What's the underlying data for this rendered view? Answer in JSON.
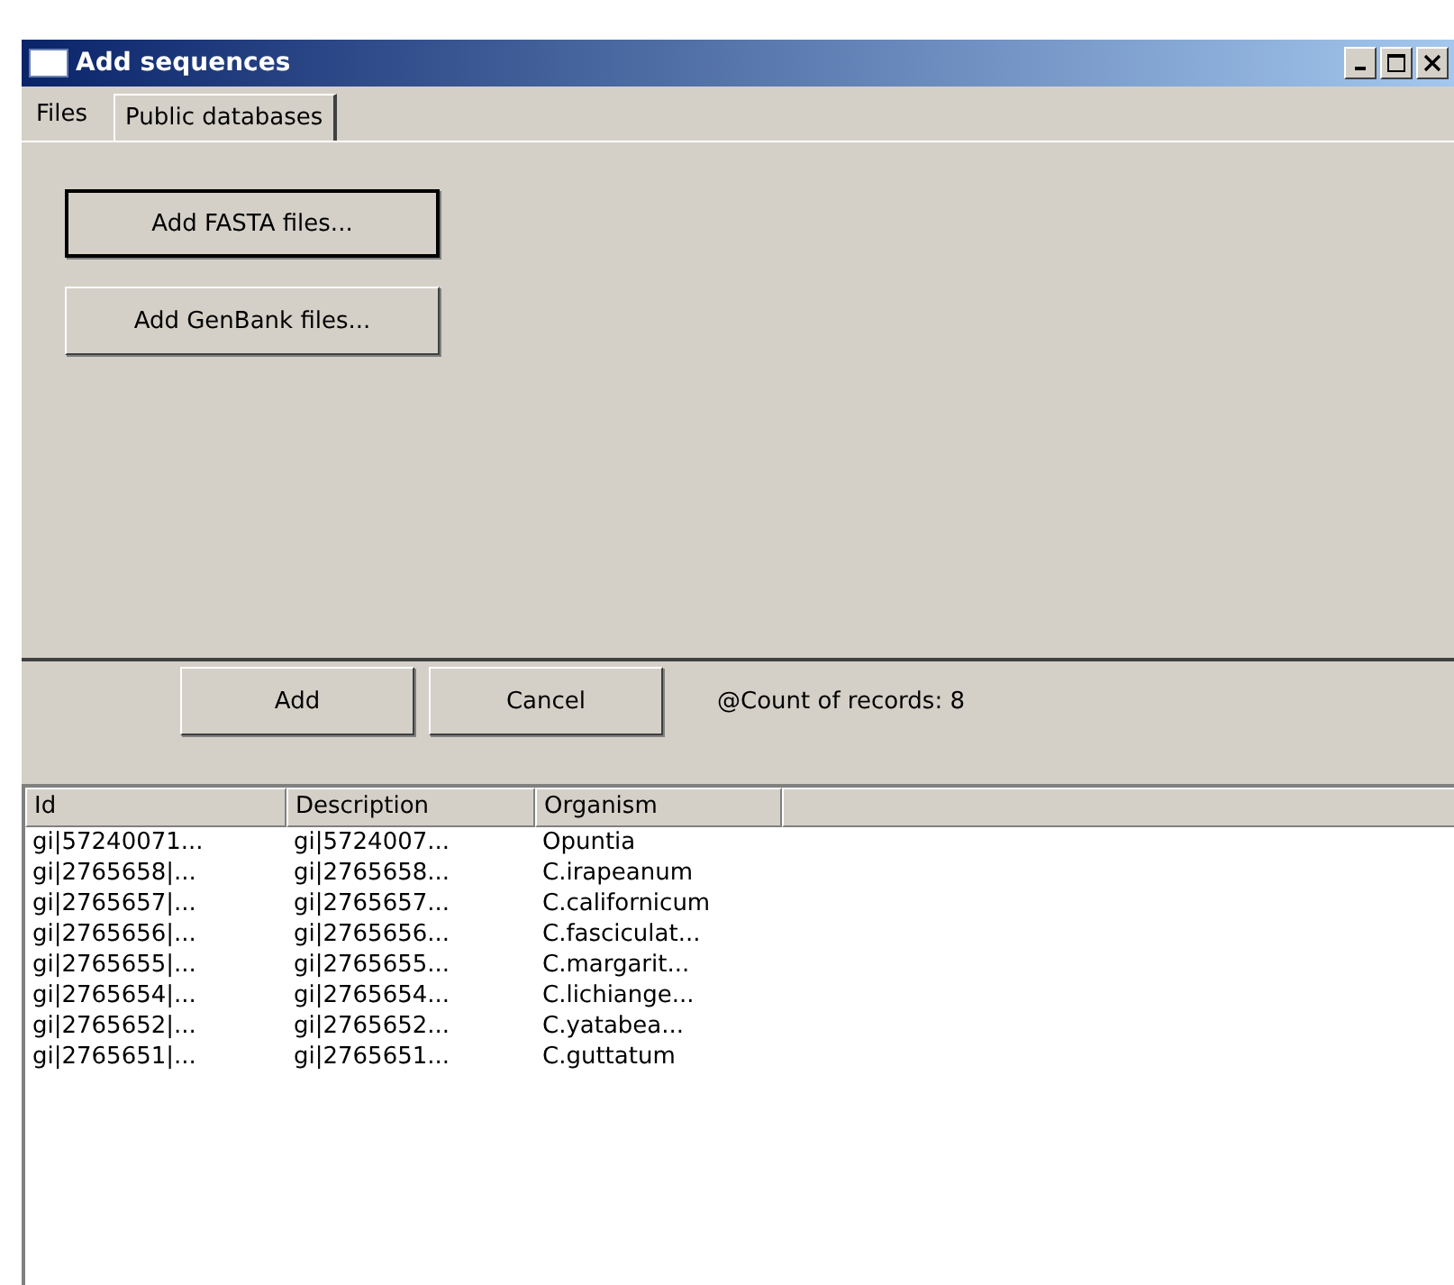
{
  "window": {
    "title": "Add sequences"
  },
  "tabs": [
    {
      "label": "Files",
      "selected": true
    },
    {
      "label": "Public databases",
      "selected": false
    }
  ],
  "file_buttons": [
    {
      "label": "Add FASTA files...",
      "focused": true
    },
    {
      "label": "Add GenBank files...",
      "focused": false
    }
  ],
  "actions": [
    "Add",
    "Cancel"
  ],
  "record_count": "@Count of records: 8",
  "table": {
    "columns": [
      "Id",
      "Description",
      "Organism"
    ],
    "rows": [
      [
        "gi|57240071...",
        "gi|5724007...",
        "Opuntia"
      ],
      [
        "gi|2765658|...",
        "gi|2765658...",
        "C.irapeanum"
      ],
      [
        "gi|2765657|...",
        "gi|2765657...",
        "C.californicum"
      ],
      [
        "gi|2765656|...",
        "gi|2765656...",
        "C.fasciculat..."
      ],
      [
        "gi|2765655|...",
        "gi|2765655...",
        "C.margarit..."
      ],
      [
        "gi|2765654|...",
        "gi|2765654...",
        "C.lichiange..."
      ],
      [
        "gi|2765652|...",
        "gi|2765652...",
        "C.yatabea..."
      ],
      [
        "gi|2765651|...",
        "gi|2765651...",
        "C.guttatum"
      ]
    ]
  }
}
